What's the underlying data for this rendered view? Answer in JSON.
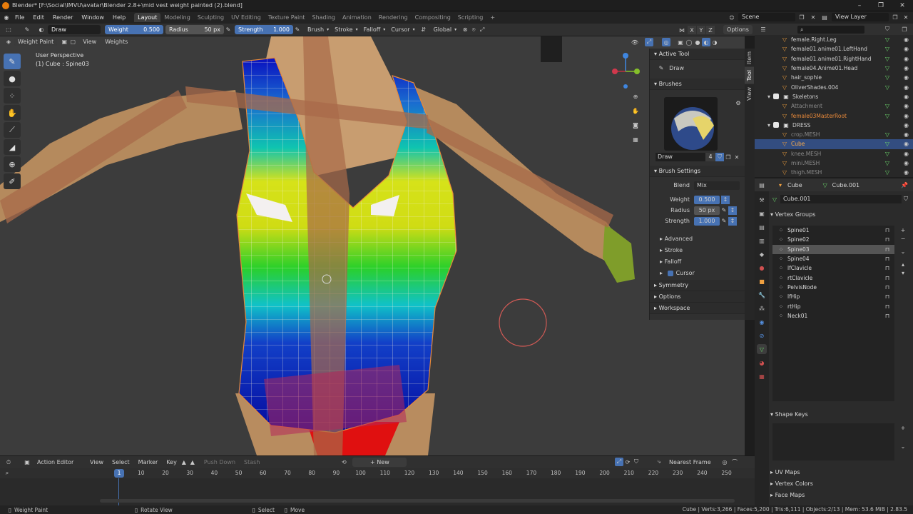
{
  "window": {
    "title": "Blender* [F:\\Social\\IMVU\\avatar\\Blender 2.8+\\mid vest weight painted (2).blend]",
    "controls": [
      "–",
      "❐",
      "✕"
    ]
  },
  "menu": {
    "items": [
      "File",
      "Edit",
      "Render",
      "Window",
      "Help"
    ],
    "workspaces": [
      "Layout",
      "Modeling",
      "Sculpting",
      "UV Editing",
      "Texture Paint",
      "Shading",
      "Animation",
      "Rendering",
      "Compositing",
      "Scripting"
    ],
    "active_workspace": "Layout",
    "scene": "Scene",
    "view_layer": "View Layer"
  },
  "tool_header": {
    "brush_name": "Draw",
    "weight_label": "Weight",
    "weight_value": "0.500",
    "radius_label": "Radius",
    "radius_value": "50 px",
    "strength_label": "Strength",
    "strength_value": "1.000",
    "menus": [
      "Brush",
      "Stroke",
      "Falloff",
      "Cursor"
    ],
    "orientation": "Global",
    "axes": [
      "X",
      "Y",
      "Z"
    ],
    "options": "Options"
  },
  "viewport": {
    "mode": "Weight Paint",
    "menus": [
      "View",
      "Weights"
    ],
    "info_line1": "User Perspective",
    "info_line2": "(1) Cube : Spine03"
  },
  "npanel": {
    "tabs": [
      "Item",
      "Tool",
      "View"
    ],
    "active_tool_title": "Active Tool",
    "active_tool_name": "Draw",
    "brushes_title": "Brushes",
    "brush_name": "Draw",
    "brush_users": "4",
    "brush_settings_title": "Brush Settings",
    "blend_label": "Blend",
    "blend_value": "Mix",
    "weight_label": "Weight",
    "weight_value": "0.500",
    "radius_label": "Radius",
    "radius_value": "50 px",
    "strength_label": "Strength",
    "strength_value": "1.000",
    "subpanels": [
      "Advanced",
      "Stroke",
      "Falloff",
      "Cursor"
    ],
    "sections": [
      "Symmetry",
      "Options",
      "Workspace"
    ]
  },
  "outliner": {
    "rows": [
      {
        "label": "female.Right.Leg",
        "indent": 3,
        "dim": false,
        "sel": false
      },
      {
        "label": "female01.anime01.LeftHand",
        "indent": 3,
        "dim": false,
        "sel": false
      },
      {
        "label": "female01.anime01.RightHand",
        "indent": 3,
        "dim": false,
        "sel": false
      },
      {
        "label": "female04.Anime01.Head",
        "indent": 3,
        "dim": false,
        "sel": false
      },
      {
        "label": "hair_sophie",
        "indent": 3,
        "dim": false,
        "sel": false
      },
      {
        "label": "OliverShades.004",
        "indent": 3,
        "dim": false,
        "sel": false
      },
      {
        "label": "Skeletons",
        "indent": 2,
        "dim": false,
        "sel": false
      },
      {
        "label": "Attachment",
        "indent": 3,
        "dim": true,
        "sel": false
      },
      {
        "label": "female03MasterRoot",
        "indent": 3,
        "dim": false,
        "sel": false,
        "orange": true
      },
      {
        "label": "DRESS",
        "indent": 2,
        "dim": false,
        "sel": false
      },
      {
        "label": "crop.MESH",
        "indent": 3,
        "dim": true,
        "sel": false
      },
      {
        "label": "Cube",
        "indent": 3,
        "dim": false,
        "sel": true,
        "orange": true
      },
      {
        "label": "knee.MESH",
        "indent": 3,
        "dim": true,
        "sel": false
      },
      {
        "label": "mini.MESH",
        "indent": 3,
        "dim": true,
        "sel": false
      },
      {
        "label": "thigh.MESH",
        "indent": 3,
        "dim": true,
        "sel": false
      }
    ]
  },
  "properties": {
    "object": "Cube",
    "mesh": "Cube.001",
    "data_name": "Cube.001",
    "vertex_groups_title": "Vertex Groups",
    "vertex_groups": [
      "Spine01",
      "Spine02",
      "Spine03",
      "Spine04",
      "lfClavicle",
      "rtClavicle",
      "PelvisNode",
      "lfHip",
      "rtHip",
      "Neck01"
    ],
    "selected_group": "Spine03",
    "shape_keys_title": "Shape Keys",
    "extra_panels": [
      "UV Maps",
      "Vertex Colors",
      "Face Maps"
    ]
  },
  "timeline": {
    "editor": "Action Editor",
    "menus": [
      "View",
      "Select",
      "Marker",
      "Key"
    ],
    "push_down": "Push Down",
    "stash": "Stash",
    "new_label": "New",
    "interp": "Nearest Frame",
    "current_frame": "1",
    "ticks": [
      10,
      20,
      30,
      40,
      50,
      60,
      70,
      80,
      90,
      100,
      110,
      120,
      130,
      140,
      150,
      160,
      170,
      180,
      190,
      200,
      210,
      220,
      230,
      240,
      250
    ]
  },
  "status": {
    "left": "Weight Paint",
    "rotate": "Rotate View",
    "select": "Select",
    "move": "Move",
    "stats": "Cube | Verts:3,266 | Faces:5,200 | Tris:6,111 | Objects:2/13 | Mem: 53.6 MiB | 2.83.5"
  }
}
